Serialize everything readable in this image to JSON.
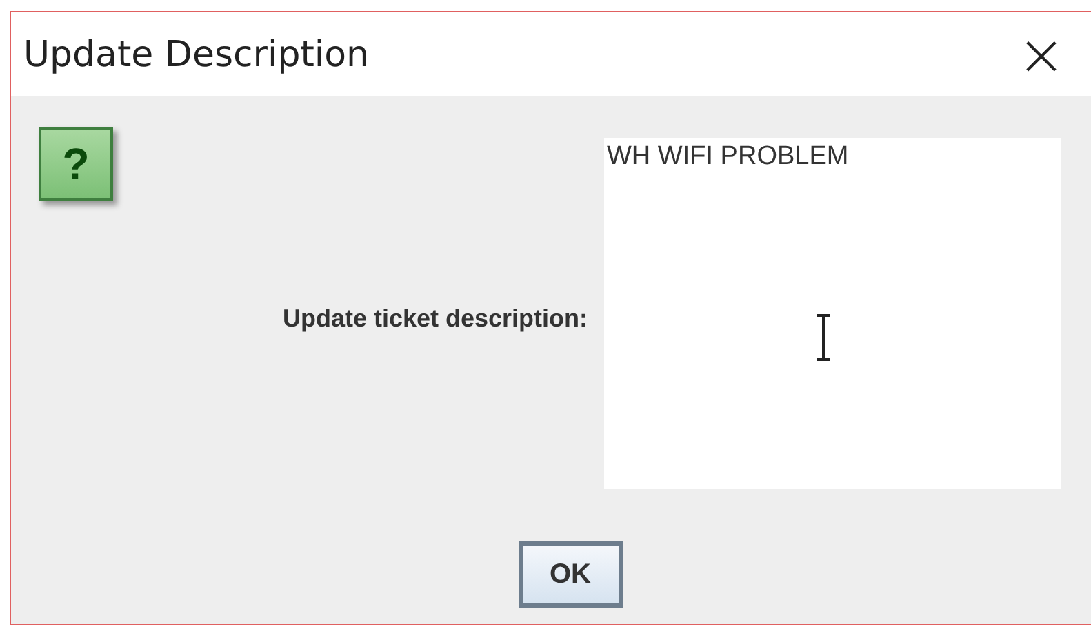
{
  "window": {
    "title": "Update Description",
    "close": "×"
  },
  "dialog": {
    "icon_glyph": "?",
    "label": "Update ticket description:",
    "description": {
      "value": "WH WIFI PROBLEM"
    },
    "buttons": [
      "OK"
    ]
  }
}
